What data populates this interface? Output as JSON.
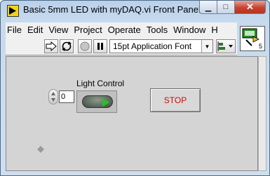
{
  "window": {
    "title": "Basic 5mm LED with myDAQ.vi Front Panel",
    "minimize_glyph": "▁",
    "maximize_glyph": "□",
    "close_glyph": "✕"
  },
  "menu": {
    "items": [
      "File",
      "Edit",
      "View",
      "Project",
      "Operate",
      "Tools",
      "Window",
      "H"
    ]
  },
  "toolbar": {
    "font_selector": "15pt Application Font"
  },
  "vi_icon": {
    "label": "5"
  },
  "panel": {
    "numeric_value": "0",
    "light_label": "Light Control",
    "stop_label": "STOP"
  },
  "colors": {
    "stop_text": "#c81010",
    "led_arrow": "#22c422"
  }
}
